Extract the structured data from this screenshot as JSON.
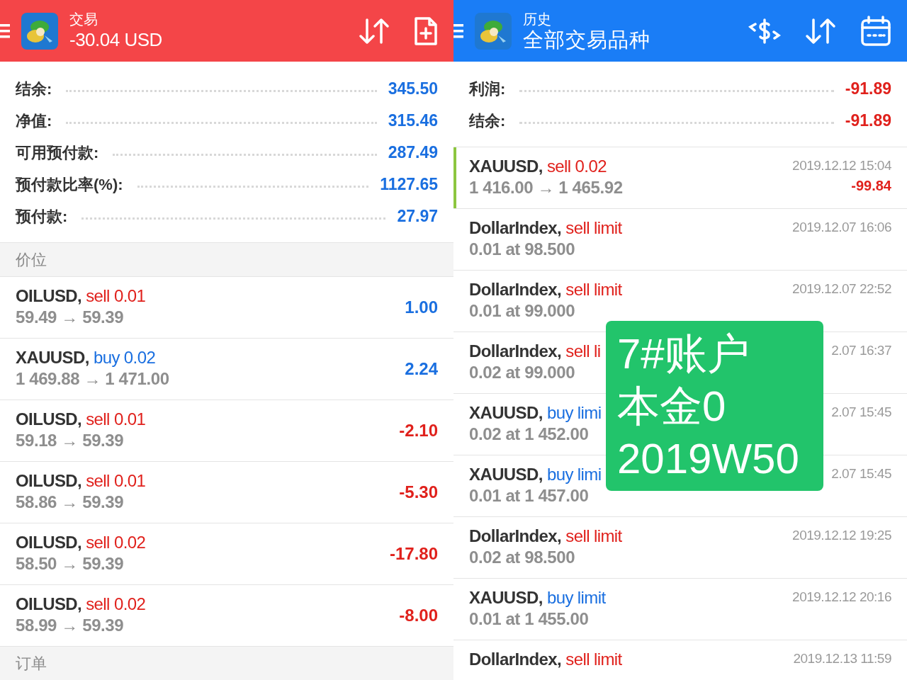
{
  "trade_panel": {
    "header": {
      "subtitle": "交易",
      "title": "-30.04 USD"
    },
    "summary": [
      {
        "label": "结余:",
        "value": "345.50",
        "negative": false
      },
      {
        "label": "净值:",
        "value": "315.46",
        "negative": false
      },
      {
        "label": "可用预付款:",
        "value": "287.49",
        "negative": false
      },
      {
        "label": "预付款比率(%):",
        "value": "1127.65",
        "negative": false
      },
      {
        "label": "预付款:",
        "value": "27.97",
        "negative": false
      }
    ],
    "positions_header": "价位",
    "positions": [
      {
        "symbol": "OILUSD,",
        "order": "sell 0.01",
        "kind": "sell",
        "prices": "59.49 → 59.39",
        "profit": "1.00",
        "loss": false
      },
      {
        "symbol": "XAUUSD,",
        "order": "buy 0.02",
        "kind": "buy",
        "prices": "1 469.88 → 1 471.00",
        "profit": "2.24",
        "loss": false
      },
      {
        "symbol": "OILUSD,",
        "order": "sell 0.01",
        "kind": "sell",
        "prices": "59.18 → 59.39",
        "profit": "-2.10",
        "loss": true
      },
      {
        "symbol": "OILUSD,",
        "order": "sell 0.01",
        "kind": "sell",
        "prices": "58.86 → 59.39",
        "profit": "-5.30",
        "loss": true
      },
      {
        "symbol": "OILUSD,",
        "order": "sell 0.02",
        "kind": "sell",
        "prices": "58.50 → 59.39",
        "profit": "-17.80",
        "loss": true
      },
      {
        "symbol": "OILUSD,",
        "order": "sell 0.02",
        "kind": "sell",
        "prices": "58.99 → 59.39",
        "profit": "-8.00",
        "loss": true
      }
    ],
    "orders_header": "订单"
  },
  "history_panel": {
    "header": {
      "subtitle": "历史",
      "title": "全部交易品种"
    },
    "summary": [
      {
        "label": "利润:",
        "value": "-91.89",
        "negative": true
      },
      {
        "label": "结余:",
        "value": "-91.89",
        "negative": true
      }
    ],
    "deals": [
      {
        "symbol": "XAUUSD,",
        "order": "sell 0.02",
        "kind": "sell",
        "detail": "1 416.00 → 1 465.92",
        "time": "2019.12.12 15:04",
        "profit": "-99.84",
        "selected": true
      },
      {
        "symbol": "DollarIndex,",
        "order": "sell limit",
        "kind": "sell",
        "detail": "0.01 at 98.500",
        "time": "2019.12.07 16:06",
        "selected": false
      },
      {
        "symbol": "DollarIndex,",
        "order": "sell limit",
        "kind": "sell",
        "detail": "0.01 at 99.000",
        "time": "2019.12.07 22:52",
        "selected": false
      },
      {
        "symbol": "DollarIndex,",
        "order": "sell li",
        "kind": "sell",
        "detail": "0.02 at 99.000",
        "time": "2.07 16:37",
        "selected": false
      },
      {
        "symbol": "XAUUSD,",
        "order": "buy limi",
        "kind": "buy",
        "detail": "0.02 at 1 452.00",
        "time": "2.07 15:45",
        "selected": false
      },
      {
        "symbol": "XAUUSD,",
        "order": "buy limi",
        "kind": "buy",
        "detail": "0.01 at 1 457.00",
        "time": "2.07 15:45",
        "selected": false
      },
      {
        "symbol": "DollarIndex,",
        "order": "sell limit",
        "kind": "sell",
        "detail": "0.02 at 98.500",
        "time": "2019.12.12 19:25",
        "selected": false
      },
      {
        "symbol": "XAUUSD,",
        "order": "buy limit",
        "kind": "buy",
        "detail": "0.01 at 1 455.00",
        "time": "2019.12.12 20:16",
        "selected": false
      },
      {
        "symbol": "DollarIndex,",
        "order": "sell limit",
        "kind": "sell",
        "time": "2019.12.13 11:59",
        "selected": false
      }
    ]
  },
  "sticker": {
    "lines": [
      "7#账户",
      "本金0",
      "2019W50"
    ]
  }
}
